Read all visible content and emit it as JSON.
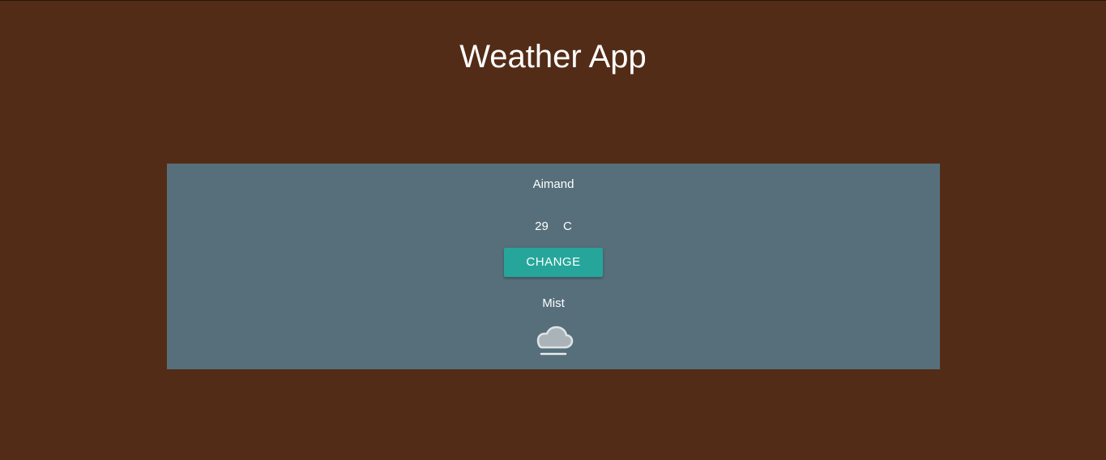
{
  "header": {
    "title": "Weather App"
  },
  "weather": {
    "city": "Aimand",
    "temperature": "29",
    "unit": "C",
    "change_label": "CHANGE",
    "condition": "Mist",
    "condition_icon": "mist-cloud-icon"
  },
  "colors": {
    "background": "#532c17",
    "card": "#566f7b",
    "button": "#26a69a",
    "text": "#ffffff"
  }
}
